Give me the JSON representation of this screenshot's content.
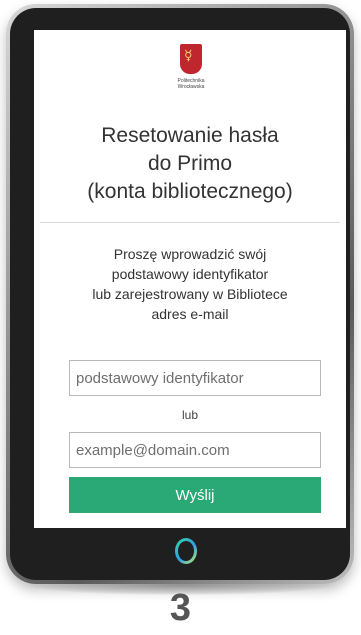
{
  "logo": {
    "mark": "☿",
    "caption_line1": "Politechnika",
    "caption_line2": "Wrocławska",
    "brand_color": "#c0262d"
  },
  "title": {
    "line1": "Resetowanie hasła",
    "line2": "do Primo",
    "line3": "(konta bibliotecznego)"
  },
  "instructions": {
    "line1": "Proszę wprowadzić swój",
    "line2": "podstawowy identyfikator",
    "line3": "lub zarejestrowany w Bibliotece",
    "line4": "adres e-mail"
  },
  "form": {
    "id_placeholder": "podstawowy identyfikator",
    "or_label": "lub",
    "email_placeholder": "example@domain.com",
    "submit_label": "Wyślij",
    "submit_color": "#2aa876"
  },
  "device": {
    "home_button_icon": "ring-icon"
  },
  "slide_number": "3"
}
